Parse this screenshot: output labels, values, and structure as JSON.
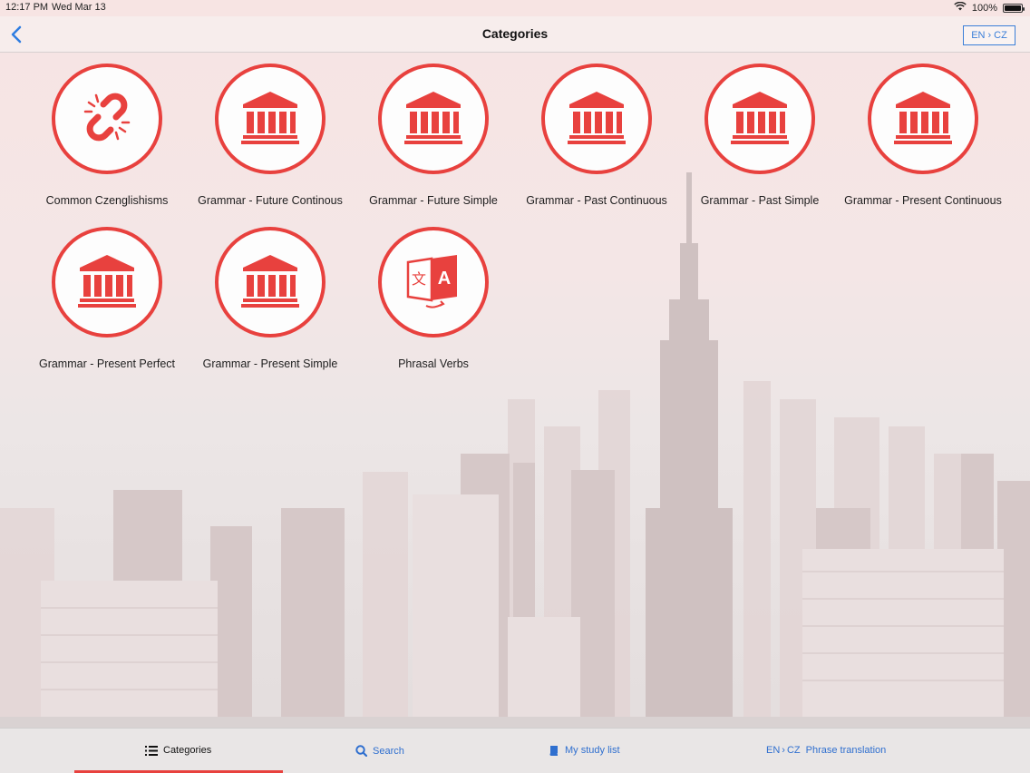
{
  "status_bar": {
    "time": "12:17 PM",
    "date": "Wed Mar 13",
    "battery": "100%",
    "battery_level": 1.0
  },
  "nav": {
    "title": "Categories",
    "language_from": "EN",
    "language_to": "CZ"
  },
  "categories": [
    {
      "label": "Common Czenglishisms",
      "icon": "broken-link-icon"
    },
    {
      "label": "Grammar - Future Continous",
      "icon": "bank-icon"
    },
    {
      "label": "Grammar - Future Simple",
      "icon": "bank-icon"
    },
    {
      "label": "Grammar - Past Continuous",
      "icon": "bank-icon"
    },
    {
      "label": "Grammar - Past Simple",
      "icon": "bank-icon"
    },
    {
      "label": "Grammar - Present Continuous",
      "icon": "bank-icon"
    },
    {
      "label": "Grammar - Present Perfect",
      "icon": "bank-icon"
    },
    {
      "label": "Grammar - Present Simple",
      "icon": "bank-icon"
    },
    {
      "label": "Phrasal Verbs",
      "icon": "translate-icon"
    }
  ],
  "tabs": {
    "categories": "Categories",
    "search": "Search",
    "study_list": "My study list",
    "phrase_prefix_from": "EN",
    "phrase_prefix_to": "CZ",
    "phrase": "Phrase translation"
  },
  "colors": {
    "accent": "#e8413e",
    "link": "#2f6fcf"
  }
}
